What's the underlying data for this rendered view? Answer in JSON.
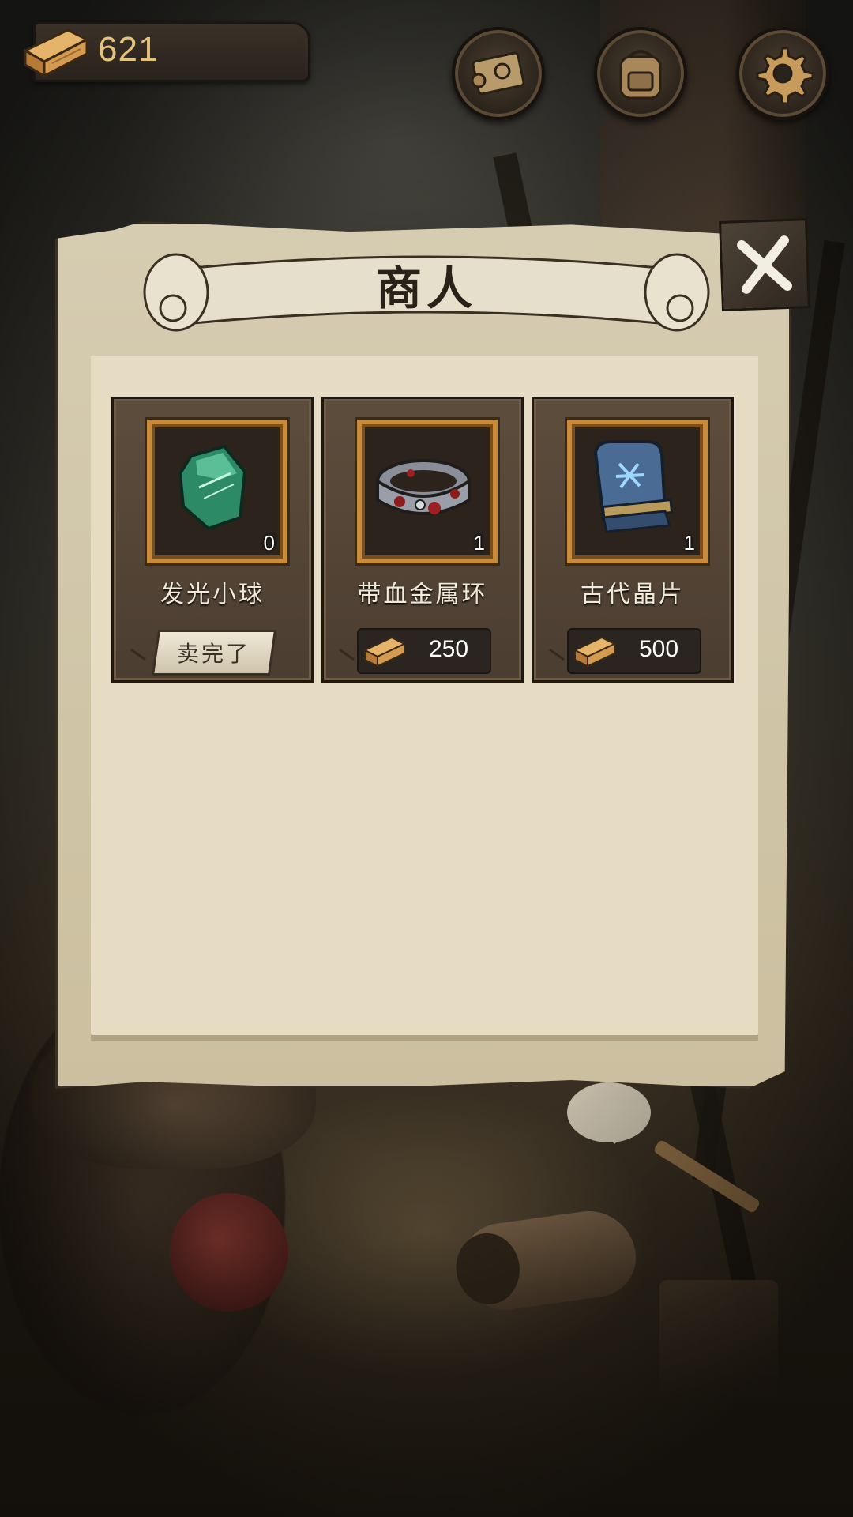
{
  "hud": {
    "wood_count": "621",
    "buttons": [
      {
        "icon": "map-scroll-icon"
      },
      {
        "icon": "backpack-icon"
      },
      {
        "icon": "gear-icon"
      }
    ]
  },
  "panel": {
    "title": "商人",
    "close_icon": "close-x-icon"
  },
  "items": [
    {
      "name": "发光小球",
      "quantity": "0",
      "icon": "glowing-orb-icon",
      "status": "卖完了",
      "price": null
    },
    {
      "name": "带血金属环",
      "quantity": "1",
      "icon": "bloody-metal-ring-icon",
      "status": null,
      "price": "250"
    },
    {
      "name": "古代晶片",
      "quantity": "1",
      "icon": "ancient-chip-icon",
      "status": null,
      "price": "500"
    }
  ],
  "colors": {
    "currency": "#e3c27c",
    "frame": "#c98a3a",
    "parchment": "#e5dcc3"
  }
}
